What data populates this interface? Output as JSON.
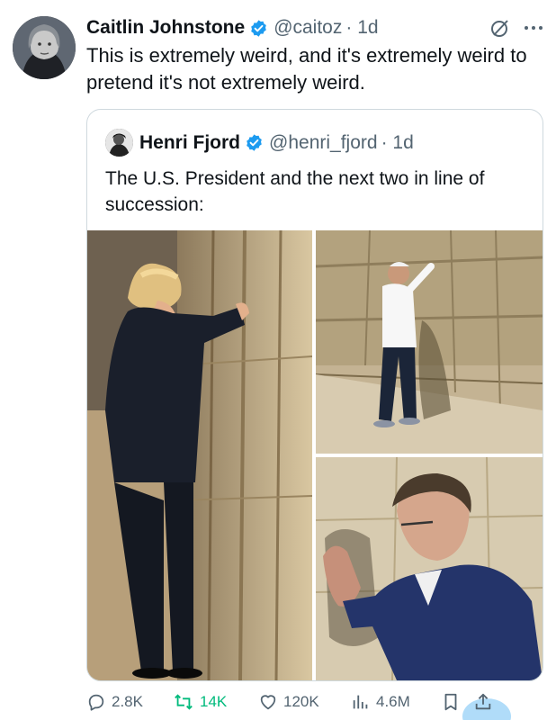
{
  "tweet": {
    "author": "Caitlin Johnstone",
    "handle": "@caitoz",
    "time": "· 1d",
    "text": "This is extremely weird, and it's extremely weird to pretend it's not extremely weird."
  },
  "quote": {
    "author": "Henri Fjord",
    "handle": "@henri_fjord",
    "time": "· 1d",
    "text": "The U.S. President and the next two in line of succession:"
  },
  "actions": {
    "replies": "2.8K",
    "reposts": "14K",
    "likes": "120K",
    "views": "4.6M"
  },
  "colors": {
    "verified": "#1d9bf0",
    "repost": "#00ba7c",
    "muted": "#536471"
  }
}
